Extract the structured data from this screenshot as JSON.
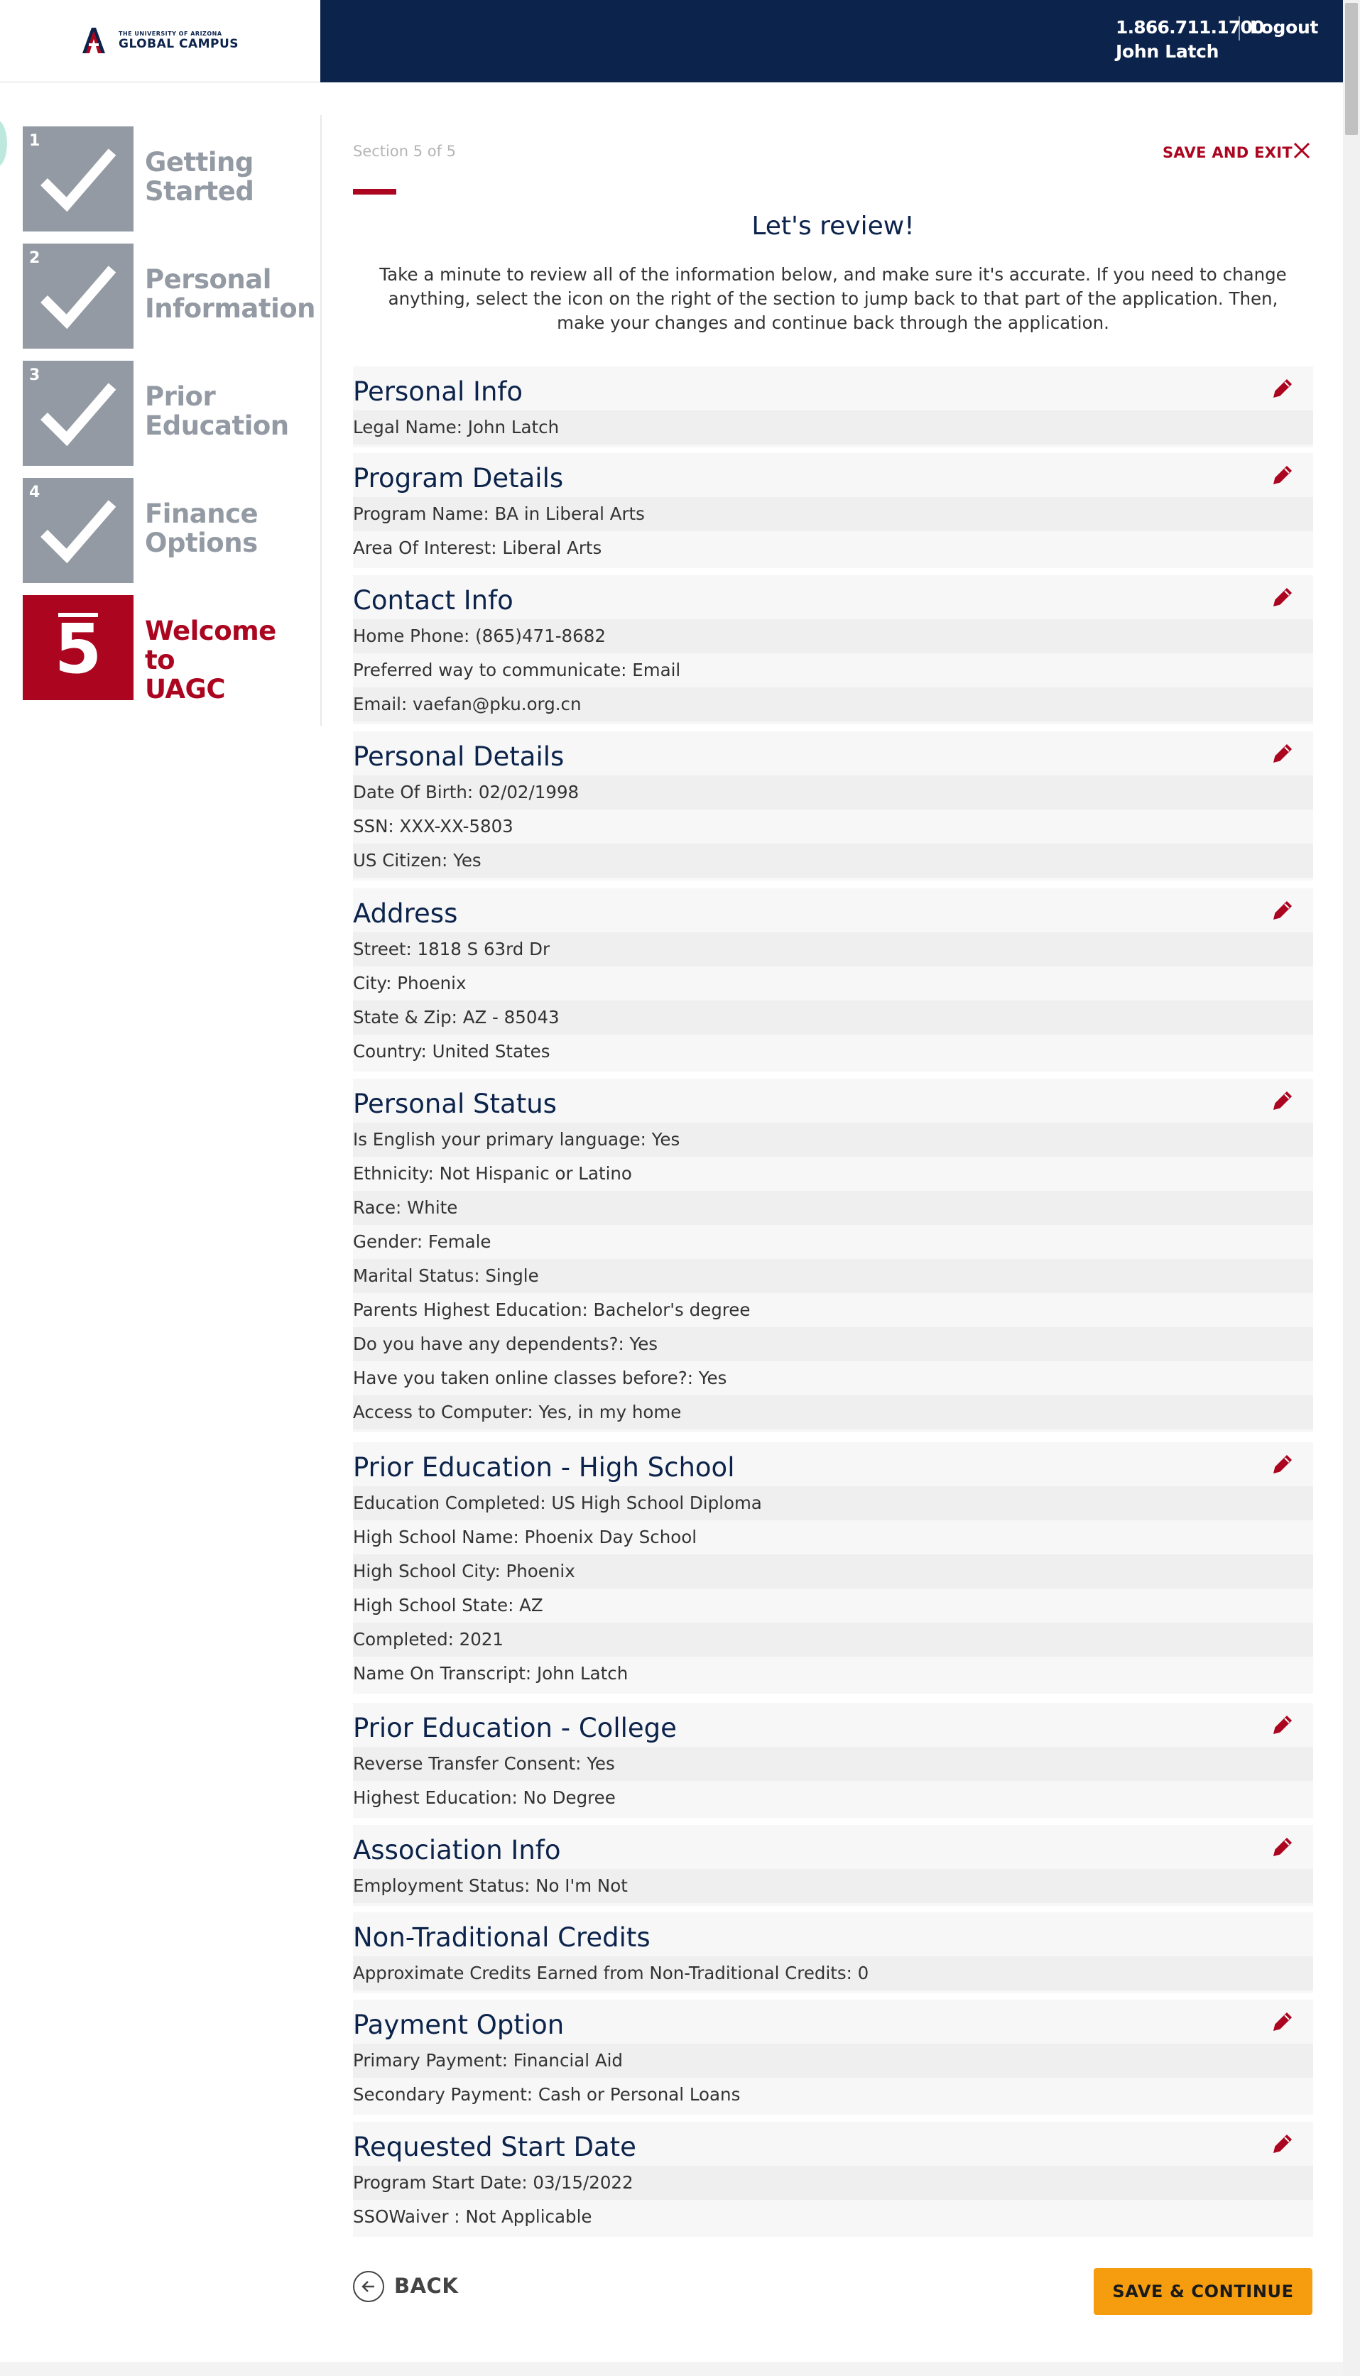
{
  "header": {
    "logo_small": "THE UNIVERSITY OF ARIZONA",
    "logo_big": "GLOBAL CAMPUS",
    "phone": "1.866.711.1700",
    "logout": "Logout",
    "user_name": "John Latch"
  },
  "steps": [
    {
      "num": "1",
      "label_line1": "Getting",
      "label_line2": "Started",
      "status": "complete"
    },
    {
      "num": "2",
      "label_line1": "Personal",
      "label_line2": "Information",
      "status": "complete"
    },
    {
      "num": "3",
      "label_line1": "Prior",
      "label_line2": "Education",
      "status": "complete"
    },
    {
      "num": "4",
      "label_line1": "Finance",
      "label_line2": "Options",
      "status": "complete"
    },
    {
      "num": "5",
      "label_line1": "Welcome to",
      "label_line2": "UAGC",
      "status": "active"
    }
  ],
  "main": {
    "section_counter": "Section 5 of 5",
    "save_exit": "SAVE AND EXIT",
    "title": "Let's review!",
    "intro": "Take a minute to review all of the information below, and make sure it's accurate. If you need to change anything, select the icon on the right of the section to jump back to that part of the application. Then, make your changes and continue back through the application."
  },
  "sections": [
    {
      "title": "Personal Info",
      "rows": [
        "Legal Name: John Latch"
      ]
    },
    {
      "title": "Program Details",
      "rows": [
        "Program Name: BA in Liberal Arts",
        "Area Of Interest: Liberal Arts"
      ]
    },
    {
      "title": "Contact Info",
      "rows": [
        "Home Phone: (865)471-8682",
        "Preferred way to communicate: Email",
        "Email: vaefan@pku.org.cn"
      ]
    },
    {
      "title": "Personal Details",
      "rows": [
        "Date Of Birth: 02/02/1998",
        "SSN: XXX-XX-5803",
        "US Citizen: Yes"
      ]
    },
    {
      "title": "Address",
      "rows": [
        "Street: 1818 S 63rd Dr",
        "City: Phoenix",
        "State & Zip: AZ - 85043",
        "Country: United States"
      ]
    },
    {
      "title": "Personal Status",
      "rows": [
        "Is English your primary language: Yes",
        "Ethnicity: Not Hispanic or Latino",
        "Race: White",
        "Gender: Female",
        "Marital Status: Single",
        "Parents Highest Education: Bachelor's degree",
        "Do you have any dependents?: Yes",
        "Have you taken online classes before?: Yes",
        "Access to Computer: Yes, in my home"
      ]
    },
    {
      "title": "Prior Education - High School",
      "rows": [
        "Education Completed: US High School Diploma",
        "High School Name: Phoenix Day School",
        "High School City: Phoenix",
        "High School State: AZ",
        "Completed: 2021",
        "Name On Transcript: John Latch"
      ]
    },
    {
      "title": "Prior Education - College",
      "rows": [
        "Reverse Transfer Consent: Yes",
        "Highest Education: No Degree"
      ]
    },
    {
      "title": "Association Info",
      "rows": [
        "Employment Status: No I'm Not"
      ]
    },
    {
      "title": "Non-Traditional Credits",
      "rows": [
        "Approximate Credits Earned from Non-Traditional Credits: 0"
      ]
    },
    {
      "title": "Payment Option",
      "rows": [
        "Primary Payment: Financial Aid",
        "Secondary Payment: Cash or Personal Loans"
      ]
    },
    {
      "title": "Requested Start Date",
      "rows": [
        "Program Start Date: 03/15/2022",
        "SSOWaiver : Not Applicable"
      ]
    }
  ],
  "footer": {
    "back": "BACK",
    "save_continue": "SAVE & CONTINUE"
  },
  "colors": {
    "navy": "#0c234b",
    "red": "#ab0520",
    "gray_step": "#939aa3",
    "orange": "#f59d0e"
  }
}
